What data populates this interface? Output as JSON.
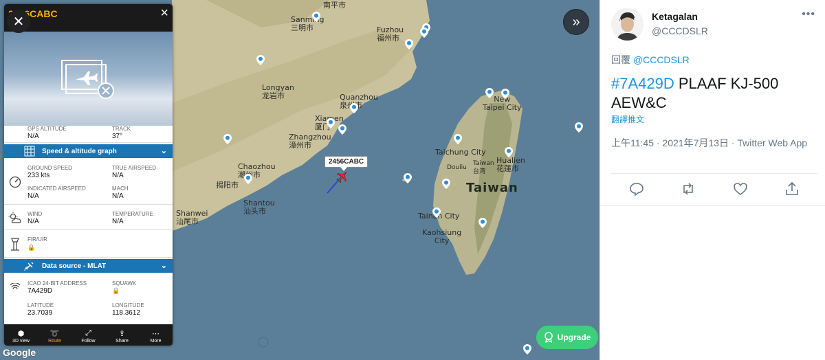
{
  "map": {
    "labels": {
      "sanming": "Sanming\n三明市",
      "fuzhou": "Fuzhou\n福州市",
      "longyan": "Longyan\n龙岩市",
      "quanzhou": "Quanzhou\n泉州市",
      "xiamen": "Xiamen\n厦门",
      "zhangzhou": "Zhangzhou\n漳州市",
      "chaozhou": "Chaozhou\n潮州市",
      "jieyang": "揭阳市",
      "shantou": "Shantou\n汕头市",
      "shanwei": "Shanwei\n汕尾市",
      "nanping": "南平市",
      "new_taipei": "New\nTaipei City",
      "taichung": "Taichung City",
      "douliu": "Douliu",
      "taiwan_city": "Taiwan\n台湾",
      "hualien": "Hualien\n花蓮市",
      "taiwan": "Taiwan",
      "tainan": "Tainan City",
      "kaohsiung": "Kaohsiung\nCity"
    },
    "aircraft_tag": "2456CABC",
    "toggle_icon": "double-chevron-right-icon",
    "upgrade_label": "Upgrade",
    "google_logo": "Google"
  },
  "panel": {
    "callsign": "2456CABC",
    "close_icon": "close-icon",
    "partial_row": {
      "label_a": "GPS ALTITUDE",
      "value_a": "N/A",
      "label_b": "TRACK",
      "value_b": "37°"
    },
    "section_speed": "Speed & altitude graph",
    "speed": {
      "ground_speed_label": "GROUND SPEED",
      "ground_speed": "233 kts",
      "true_airspeed_label": "TRUE AIRSPEED",
      "true_airspeed": "N/A",
      "indicated_label": "INDICATED AIRSPEED",
      "indicated": "N/A",
      "mach_label": "MACH",
      "mach": "N/A"
    },
    "weather": {
      "wind_label": "WIND",
      "wind": "N/A",
      "temp_label": "TEMPERATURE",
      "temp": "N/A"
    },
    "fir": {
      "label": "FIR/UIR"
    },
    "section_source": "Data source - MLAT",
    "source": {
      "icao_label": "ICAO 24-BIT ADDRESS",
      "icao": "7A429D",
      "squawk_label": "SQUAWK",
      "lat_label": "LATITUDE",
      "lat": "23.7039",
      "lon_label": "LONGITUDE",
      "lon": "118.3612"
    },
    "bottom": [
      {
        "label": "3D view",
        "icon": "cube-icon"
      },
      {
        "label": "Route",
        "icon": "route-icon"
      },
      {
        "label": "Follow",
        "icon": "follow-icon"
      },
      {
        "label": "Share",
        "icon": "share-icon"
      },
      {
        "label": "More",
        "icon": "more-icon"
      }
    ]
  },
  "tweet": {
    "name": "Ketagalan",
    "handle": "@CCCDSLR",
    "reply_prefix": "回覆 ",
    "reply_handle": "@CCCDSLR",
    "hashtag": "#7A429D",
    "text_rest": " PLAAF KJ-500 AEW&C",
    "translate": "翻譯推文",
    "meta": "上午11:45 · 2021年7月13日 · Twitter Web App"
  },
  "colors": {
    "map_sea": "#5b7f98",
    "land": "#c9c29c",
    "panel_blue": "#1b74b4",
    "accent_gold": "#f4b400",
    "twitter_blue": "#1b95e0",
    "upgrade_green": "#3fcf7b"
  }
}
